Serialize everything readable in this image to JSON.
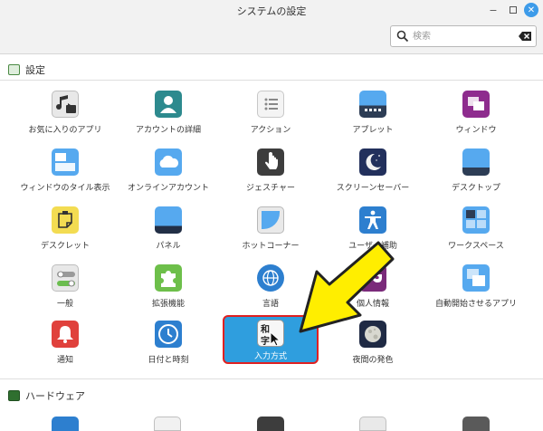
{
  "window": {
    "title": "システムの設定"
  },
  "search": {
    "placeholder": "検索"
  },
  "sections": {
    "settings": "設定",
    "hardware": "ハードウェア"
  },
  "items": [
    {
      "label": "お気に入りのアプリ"
    },
    {
      "label": "アカウントの詳細"
    },
    {
      "label": "アクション"
    },
    {
      "label": "アプレット"
    },
    {
      "label": "ウィンドウ"
    },
    {
      "label": "ウィンドウのタイル表示"
    },
    {
      "label": "オンラインアカウント"
    },
    {
      "label": "ジェスチャー"
    },
    {
      "label": "スクリーンセーバー"
    },
    {
      "label": "デスクトップ"
    },
    {
      "label": "デスクレット"
    },
    {
      "label": "パネル"
    },
    {
      "label": "ホットコーナー"
    },
    {
      "label": "ユーザー補助"
    },
    {
      "label": "ワークスペース"
    },
    {
      "label": "一般"
    },
    {
      "label": "拡張機能"
    },
    {
      "label": "言語"
    },
    {
      "label": "個人情報"
    },
    {
      "label": "自動開始させるアプリ"
    },
    {
      "label": "通知"
    },
    {
      "label": "日付と時刻"
    },
    {
      "label": "入力方式",
      "icon_text_top": "和",
      "icon_text_bottom": "字"
    },
    {
      "label": "夜間の発色"
    }
  ],
  "colors": {
    "accent": "#2f9ede",
    "highlight_border": "#e02020",
    "arrow": "#ffee00"
  }
}
